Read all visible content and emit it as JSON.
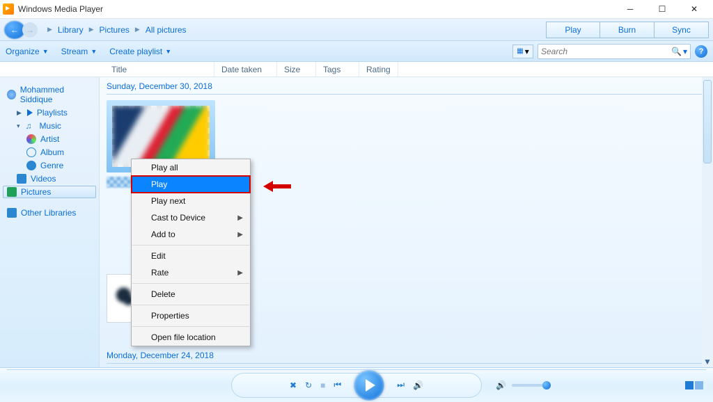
{
  "window": {
    "title": "Windows Media Player"
  },
  "breadcrumb": [
    "Library",
    "Pictures",
    "All pictures"
  ],
  "tabs": {
    "play": "Play",
    "burn": "Burn",
    "sync": "Sync"
  },
  "toolbar": {
    "organize": "Organize",
    "stream": "Stream",
    "create": "Create playlist"
  },
  "search": {
    "placeholder": "Search"
  },
  "columns": {
    "title": "Title",
    "date": "Date taken",
    "size": "Size",
    "tags": "Tags",
    "rating": "Rating"
  },
  "sidebar": {
    "user": "Mohammed Siddique",
    "playlists": "Playlists",
    "music": "Music",
    "artist": "Artist",
    "album": "Album",
    "genre": "Genre",
    "videos": "Videos",
    "pictures": "Pictures",
    "other": "Other Libraries"
  },
  "groups": {
    "g1": "Sunday, December 30, 2018",
    "g2": "Monday, December 24, 2018"
  },
  "context_menu": {
    "play_all": "Play all",
    "play": "Play",
    "play_next": "Play next",
    "cast": "Cast to Device",
    "add_to": "Add to",
    "edit": "Edit",
    "rate": "Rate",
    "delete": "Delete",
    "properties": "Properties",
    "open_loc": "Open file location"
  }
}
